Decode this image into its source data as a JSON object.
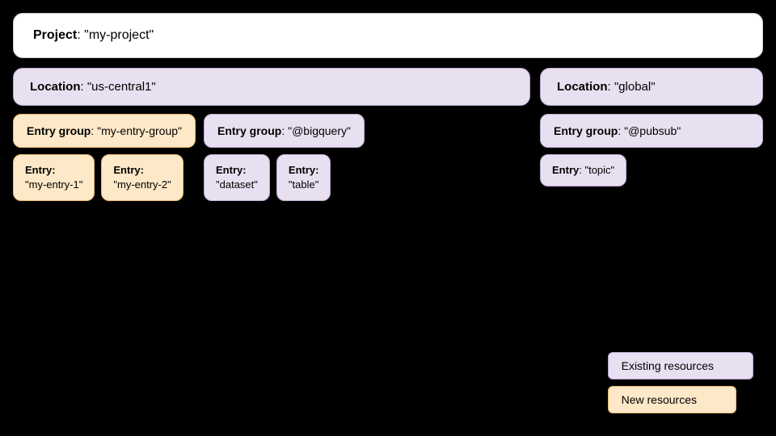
{
  "project": {
    "label": "Project",
    "value": "my-project"
  },
  "locations": [
    {
      "label": "Location",
      "value": "us-central1",
      "color": "purple",
      "entryGroups": [
        {
          "label": "Entry group",
          "value": "my-entry-group",
          "color": "orange",
          "entries": [
            {
              "label": "Entry",
              "value": "my-entry-1",
              "color": "orange"
            },
            {
              "label": "Entry",
              "value": "my-entry-2",
              "color": "orange"
            }
          ]
        },
        {
          "label": "Entry group",
          "value": "@bigquery",
          "color": "purple",
          "entries": [
            {
              "label": "Entry",
              "value": "dataset",
              "color": "purple"
            },
            {
              "label": "Entry",
              "value": "table",
              "color": "purple"
            }
          ]
        }
      ]
    },
    {
      "label": "Location",
      "value": "global",
      "color": "purple",
      "entryGroups": [
        {
          "label": "Entry group",
          "value": "@pubsub",
          "color": "purple",
          "entries": [
            {
              "label": "Entry",
              "value": "topic",
              "color": "purple"
            }
          ]
        }
      ]
    }
  ],
  "legend": {
    "existing": "Existing resources",
    "new_resources": "New resources"
  }
}
